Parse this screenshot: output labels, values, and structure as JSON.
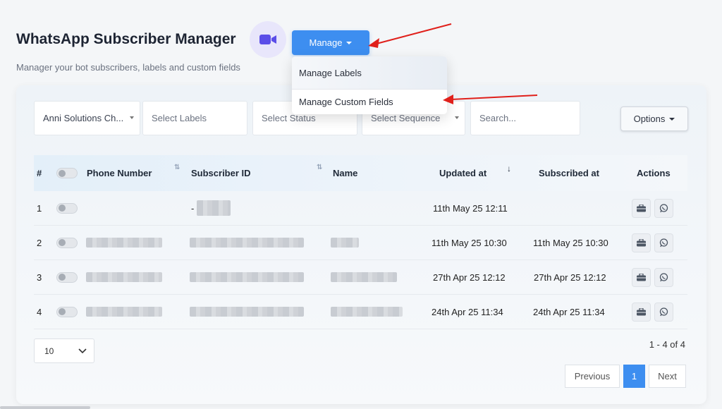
{
  "header": {
    "title": "WhatsApp Subscriber Manager",
    "subtitle": "Manager your bot subscribers, labels and custom fields",
    "manage_label": "Manage",
    "video_icon": "video-camera-icon"
  },
  "dropdown": {
    "items": [
      {
        "label": "Manage Labels"
      },
      {
        "label": "Manage Custom Fields"
      }
    ]
  },
  "filters": {
    "bot": "Anni Solutions Ch...",
    "labels_placeholder": "Select Labels",
    "status_placeholder": "Select Status",
    "sequence_placeholder": "Select Sequence",
    "search_placeholder": "Search...",
    "options_label": "Options"
  },
  "table": {
    "headers": {
      "num": "#",
      "phone": "Phone Number",
      "subscriber_id": "Subscriber ID",
      "name": "Name",
      "updated": "Updated at",
      "subscribed": "Subscribed at",
      "actions": "Actions"
    },
    "rows": [
      {
        "num": "1",
        "sub_prefix": "-",
        "updated": "11th May 25 12:11",
        "subscribed": ""
      },
      {
        "num": "2",
        "sub_prefix": "",
        "updated": "11th May 25 10:30",
        "subscribed": "11th May 25 10:30"
      },
      {
        "num": "3",
        "sub_prefix": "",
        "updated": "27th Apr 25 12:12",
        "subscribed": "27th Apr 25 12:12"
      },
      {
        "num": "4",
        "sub_prefix": "",
        "updated": "24th Apr 25 11:34",
        "subscribed": "24th Apr 25 11:34"
      }
    ]
  },
  "pagination": {
    "per_page": "10",
    "range": "1 - 4 of 4",
    "previous": "Previous",
    "current": "1",
    "next": "Next"
  },
  "colors": {
    "primary": "#3d8ef0",
    "annotation_arrow": "#e0201b"
  }
}
